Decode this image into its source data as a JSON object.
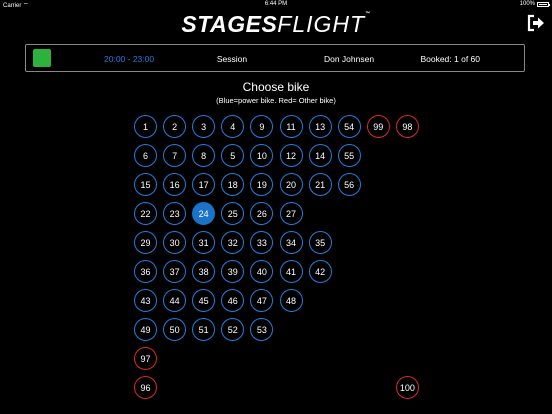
{
  "status_bar": {
    "carrier": "Carrier",
    "time": "6:44 PM",
    "battery": "100%"
  },
  "app": {
    "logo_left": "STAGES",
    "logo_right": "FLIGHT",
    "logo_mark": "™"
  },
  "session": {
    "color": "#2db33d",
    "time": "20:00 - 23:00",
    "type": "Session",
    "instructor": "Don Johnsen",
    "booked": "Booked: 1 of 60"
  },
  "picker": {
    "title": "Choose bike",
    "subtitle": "(Blue=power bike. Red= Other bike)"
  },
  "colors": {
    "power": "#1e7fe0",
    "other": "#d9282f",
    "selected": "#1a72c9"
  },
  "bikes": [
    {
      "label": "1",
      "kind": "power",
      "row": 0,
      "col": 0
    },
    {
      "label": "2",
      "kind": "power",
      "row": 0,
      "col": 1
    },
    {
      "label": "3",
      "kind": "power",
      "row": 0,
      "col": 2
    },
    {
      "label": "4",
      "kind": "power",
      "row": 0,
      "col": 3
    },
    {
      "label": "9",
      "kind": "power",
      "row": 0,
      "col": 4
    },
    {
      "label": "11",
      "kind": "power",
      "row": 0,
      "col": 5
    },
    {
      "label": "13",
      "kind": "power",
      "row": 0,
      "col": 6
    },
    {
      "label": "54",
      "kind": "power",
      "row": 0,
      "col": 7
    },
    {
      "label": "99",
      "kind": "other",
      "row": 0,
      "col": 8
    },
    {
      "label": "98",
      "kind": "other",
      "row": 0,
      "col": 9
    },
    {
      "label": "6",
      "kind": "power",
      "row": 1,
      "col": 0
    },
    {
      "label": "7",
      "kind": "power",
      "row": 1,
      "col": 1
    },
    {
      "label": "8",
      "kind": "power",
      "row": 1,
      "col": 2
    },
    {
      "label": "5",
      "kind": "power",
      "row": 1,
      "col": 3
    },
    {
      "label": "10",
      "kind": "power",
      "row": 1,
      "col": 4
    },
    {
      "label": "12",
      "kind": "power",
      "row": 1,
      "col": 5
    },
    {
      "label": "14",
      "kind": "power",
      "row": 1,
      "col": 6
    },
    {
      "label": "55",
      "kind": "power",
      "row": 1,
      "col": 7
    },
    {
      "label": "15",
      "kind": "power",
      "row": 2,
      "col": 0
    },
    {
      "label": "16",
      "kind": "power",
      "row": 2,
      "col": 1
    },
    {
      "label": "17",
      "kind": "power",
      "row": 2,
      "col": 2
    },
    {
      "label": "18",
      "kind": "power",
      "row": 2,
      "col": 3
    },
    {
      "label": "19",
      "kind": "power",
      "row": 2,
      "col": 4
    },
    {
      "label": "20",
      "kind": "power",
      "row": 2,
      "col": 5
    },
    {
      "label": "21",
      "kind": "power",
      "row": 2,
      "col": 6
    },
    {
      "label": "56",
      "kind": "power",
      "row": 2,
      "col": 7
    },
    {
      "label": "22",
      "kind": "power",
      "row": 3,
      "col": 0
    },
    {
      "label": "23",
      "kind": "power",
      "row": 3,
      "col": 1
    },
    {
      "label": "24",
      "kind": "power",
      "row": 3,
      "col": 2,
      "selected": true
    },
    {
      "label": "25",
      "kind": "power",
      "row": 3,
      "col": 3
    },
    {
      "label": "26",
      "kind": "power",
      "row": 3,
      "col": 4
    },
    {
      "label": "27",
      "kind": "power",
      "row": 3,
      "col": 5
    },
    {
      "label": "29",
      "kind": "power",
      "row": 4,
      "col": 0
    },
    {
      "label": "30",
      "kind": "power",
      "row": 4,
      "col": 1
    },
    {
      "label": "31",
      "kind": "power",
      "row": 4,
      "col": 2
    },
    {
      "label": "32",
      "kind": "power",
      "row": 4,
      "col": 3
    },
    {
      "label": "33",
      "kind": "power",
      "row": 4,
      "col": 4
    },
    {
      "label": "34",
      "kind": "power",
      "row": 4,
      "col": 5
    },
    {
      "label": "35",
      "kind": "power",
      "row": 4,
      "col": 6
    },
    {
      "label": "36",
      "kind": "power",
      "row": 5,
      "col": 0
    },
    {
      "label": "37",
      "kind": "power",
      "row": 5,
      "col": 1
    },
    {
      "label": "38",
      "kind": "power",
      "row": 5,
      "col": 2
    },
    {
      "label": "39",
      "kind": "power",
      "row": 5,
      "col": 3
    },
    {
      "label": "40",
      "kind": "power",
      "row": 5,
      "col": 4
    },
    {
      "label": "41",
      "kind": "power",
      "row": 5,
      "col": 5
    },
    {
      "label": "42",
      "kind": "power",
      "row": 5,
      "col": 6
    },
    {
      "label": "43",
      "kind": "power",
      "row": 6,
      "col": 0
    },
    {
      "label": "44",
      "kind": "power",
      "row": 6,
      "col": 1
    },
    {
      "label": "45",
      "kind": "power",
      "row": 6,
      "col": 2
    },
    {
      "label": "46",
      "kind": "power",
      "row": 6,
      "col": 3
    },
    {
      "label": "47",
      "kind": "power",
      "row": 6,
      "col": 4
    },
    {
      "label": "48",
      "kind": "power",
      "row": 6,
      "col": 5
    },
    {
      "label": "49",
      "kind": "power",
      "row": 7,
      "col": 0
    },
    {
      "label": "50",
      "kind": "power",
      "row": 7,
      "col": 1
    },
    {
      "label": "51",
      "kind": "power",
      "row": 7,
      "col": 2
    },
    {
      "label": "52",
      "kind": "power",
      "row": 7,
      "col": 3
    },
    {
      "label": "53",
      "kind": "power",
      "row": 7,
      "col": 4
    },
    {
      "label": "97",
      "kind": "other",
      "row": 8,
      "col": 0
    },
    {
      "label": "96",
      "kind": "other",
      "row": 9,
      "col": 0
    },
    {
      "label": "100",
      "kind": "other",
      "row": 9,
      "col": 9
    }
  ]
}
